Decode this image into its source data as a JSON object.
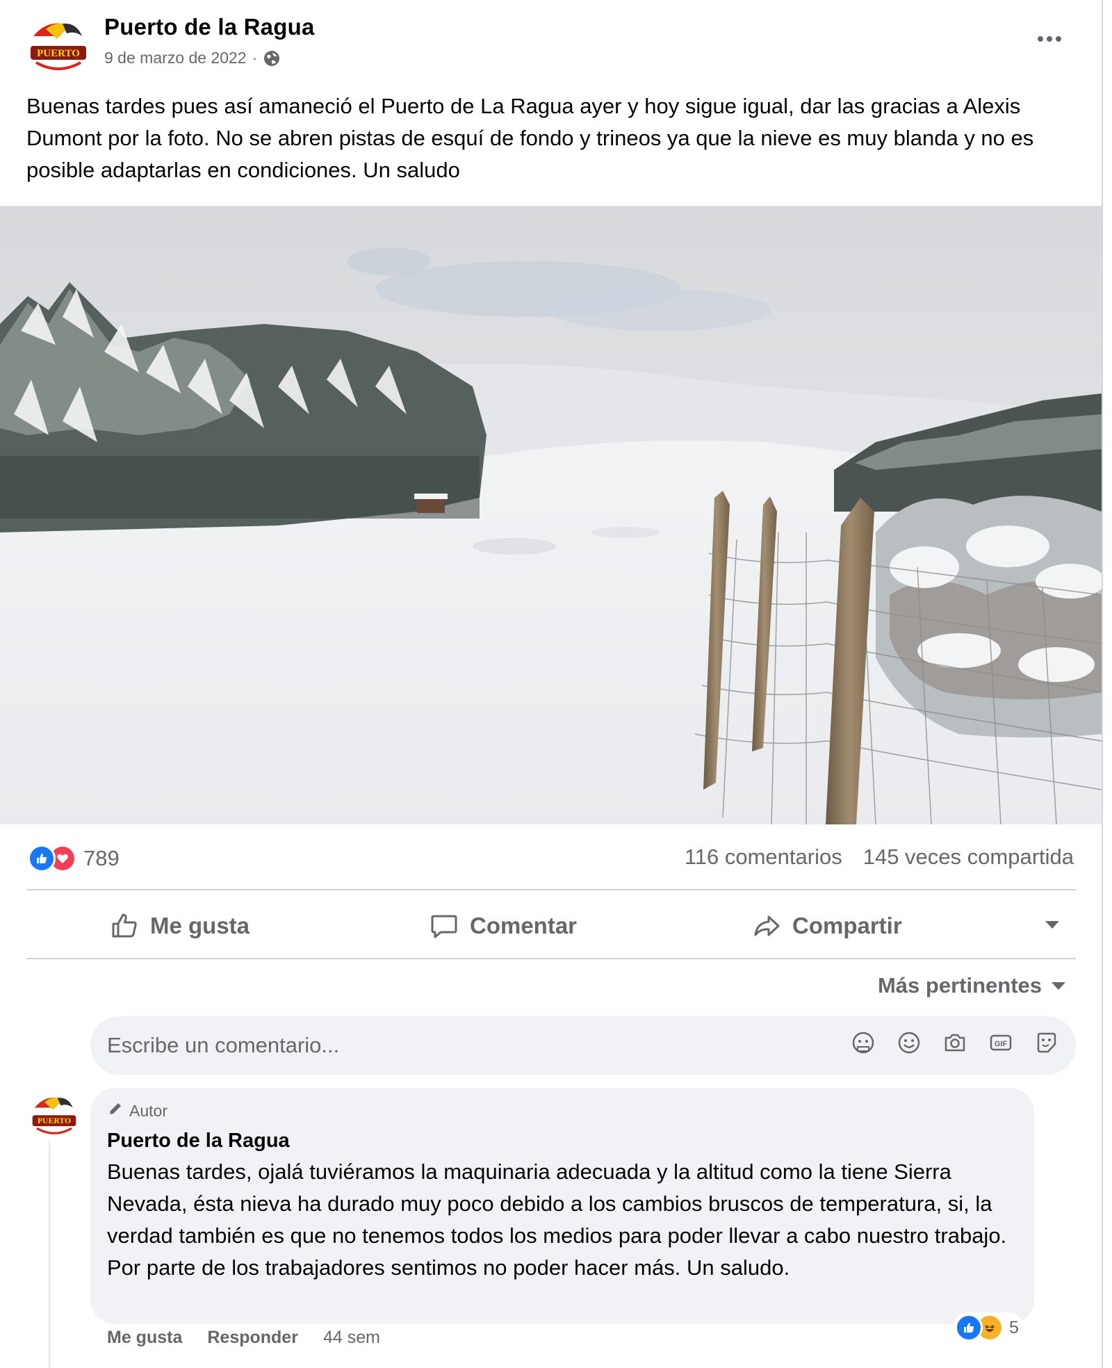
{
  "post": {
    "page_name": "Puerto de la Ragua",
    "date": "9 de marzo de 2022",
    "separator": "·",
    "text": "Buenas tardes pues así amaneció el Puerto de La Ragua ayer y hoy sigue igual, dar las gracias a Alexis Dumont por la foto. No se abren pistas de esquí de fondo y trineos ya que la nieve es muy blanda y no es posible adaptarlas en condiciones. Un saludo",
    "photo_subject": "snowy mountain pass with pine forest and wooden fence posts"
  },
  "stats": {
    "reactions_count": "789",
    "comments": "116 comentarios",
    "shares": "145 veces compartida"
  },
  "actions": {
    "like": "Me gusta",
    "comment": "Comentar",
    "share": "Compartir"
  },
  "sort": {
    "label": "Más pertinentes"
  },
  "comment_box": {
    "placeholder": "Escribe un comentario..."
  },
  "comment": {
    "badge": "Autor",
    "author": "Puerto de la Ragua",
    "text": "Buenas tardes, ojalá tuviéramos la maquinaria adecuada y la altitud como la tiene Sierra Nevada, ésta nieva ha durado muy poco debido a los cambios bruscos de temperatura, si, la verdad también es que no tenemos todos los medios para poder llevar a cabo nuestro trabajo. Por parte de los trabajadores sentimos no poder hacer más. Un saludo.",
    "reactions_count": "5",
    "like": "Me gusta",
    "reply": "Responder",
    "time": "44 sem"
  },
  "colors": {
    "brand_blue": "#1877f2",
    "love_red": "#f33e58",
    "haha_yellow": "#f7b125",
    "secondary_text": "#65676b",
    "bubble_bg": "#f0f2f5"
  }
}
